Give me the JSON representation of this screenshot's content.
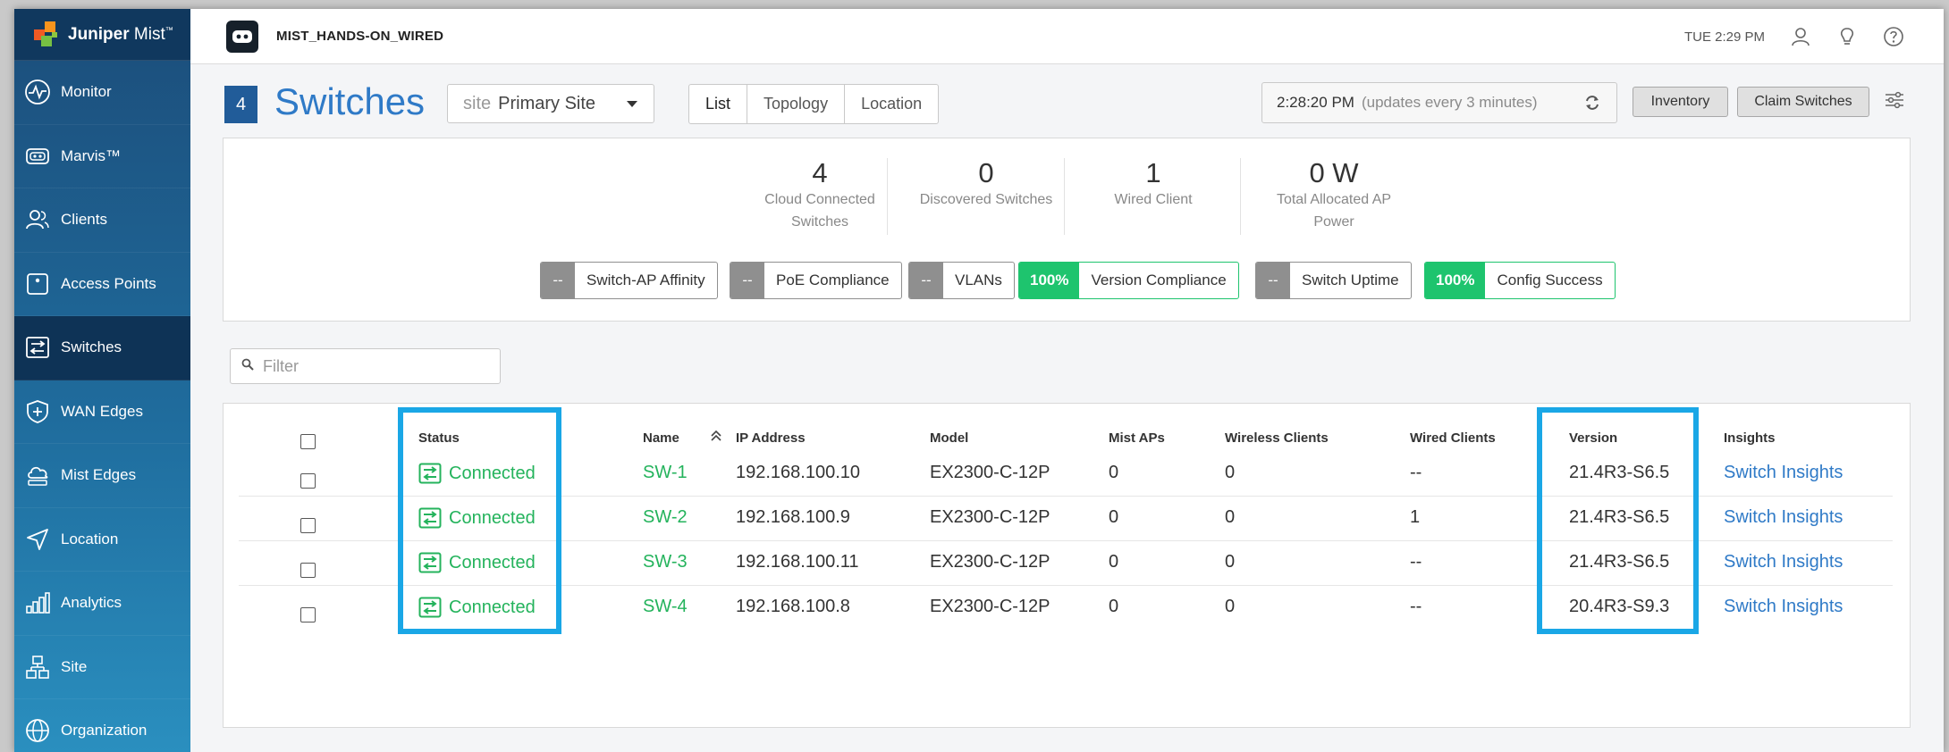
{
  "brand": {
    "name_bold": "Juniper",
    "name_light": " Mist",
    "tm": "™"
  },
  "sidebar": {
    "items": [
      {
        "label": "Monitor",
        "icon": "monitor-icon",
        "active": false
      },
      {
        "label": "Marvis™",
        "icon": "marvis-icon",
        "active": false
      },
      {
        "label": "Clients",
        "icon": "clients-icon",
        "active": false
      },
      {
        "label": "Access Points",
        "icon": "access-point-icon",
        "active": false
      },
      {
        "label": "Switches",
        "icon": "switch-icon",
        "active": true
      },
      {
        "label": "WAN Edges",
        "icon": "wan-edge-icon",
        "active": false
      },
      {
        "label": "Mist Edges",
        "icon": "cloud-icon",
        "active": false
      },
      {
        "label": "Location",
        "icon": "location-icon",
        "active": false
      },
      {
        "label": "Analytics",
        "icon": "analytics-icon",
        "active": false
      },
      {
        "label": "Site",
        "icon": "site-icon",
        "active": false
      },
      {
        "label": "Organization",
        "icon": "globe-icon",
        "active": false
      }
    ]
  },
  "topbar": {
    "org_name": "MIST_HANDS-ON_WIRED",
    "time": "TUE 2:29 PM"
  },
  "header": {
    "count": "4",
    "title": "Switches",
    "site_label": "site",
    "site_value": "Primary Site",
    "tabs": [
      "List",
      "Topology",
      "Location"
    ],
    "refresh_time": "2:28:20 PM",
    "refresh_note": "(updates every 3 minutes)",
    "inventory_label": "Inventory",
    "claim_label": "Claim Switches"
  },
  "stats": [
    {
      "value": "4",
      "label_line1": "Cloud Connected",
      "label_line2": "Switches"
    },
    {
      "value": "0",
      "label_line1": "Discovered Switches",
      "label_line2": ""
    },
    {
      "value": "1",
      "label_line1": "Wired Client",
      "label_line2": ""
    },
    {
      "value": "0 W",
      "label_line1": "Total Allocated AP",
      "label_line2": "Power"
    }
  ],
  "sle": [
    {
      "value": "--",
      "label": "Switch-AP Affinity"
    },
    {
      "value": "--",
      "label": "PoE Compliance"
    },
    {
      "value": "--",
      "label": "VLANs"
    },
    {
      "value": "100%",
      "label": "Version Compliance"
    },
    {
      "value": "--",
      "label": "Switch Uptime"
    },
    {
      "value": "100%",
      "label": "Config Success"
    }
  ],
  "filter": {
    "placeholder": "Filter"
  },
  "table": {
    "columns": [
      "Status",
      "Name",
      "IP Address",
      "Model",
      "Mist APs",
      "Wireless Clients",
      "Wired Clients",
      "Version",
      "Insights"
    ],
    "rows": [
      {
        "status": "Connected",
        "name": "SW-1",
        "ip": "192.168.100.10",
        "model": "EX2300-C-12P",
        "mist_aps": "0",
        "wireless": "0",
        "wired": "--",
        "version": "21.4R3-S6.5",
        "insights": "Switch Insights"
      },
      {
        "status": "Connected",
        "name": "SW-2",
        "ip": "192.168.100.9",
        "model": "EX2300-C-12P",
        "mist_aps": "0",
        "wireless": "0",
        "wired": "1",
        "version": "21.4R3-S6.5",
        "insights": "Switch Insights"
      },
      {
        "status": "Connected",
        "name": "SW-3",
        "ip": "192.168.100.11",
        "model": "EX2300-C-12P",
        "mist_aps": "0",
        "wireless": "0",
        "wired": "--",
        "version": "21.4R3-S6.5",
        "insights": "Switch Insights"
      },
      {
        "status": "Connected",
        "name": "SW-4",
        "ip": "192.168.100.8",
        "model": "EX2300-C-12P",
        "mist_aps": "0",
        "wireless": "0",
        "wired": "--",
        "version": "20.4R3-S9.3",
        "insights": "Switch Insights"
      }
    ]
  },
  "colors": {
    "accent": "#2f7ac7",
    "connected": "#24b35c",
    "sle_green": "#1ec46e",
    "highlight": "#1aa7e6",
    "sidebar_top": "#1c4d7a",
    "sidebar_bottom": "#2a8fbf"
  }
}
